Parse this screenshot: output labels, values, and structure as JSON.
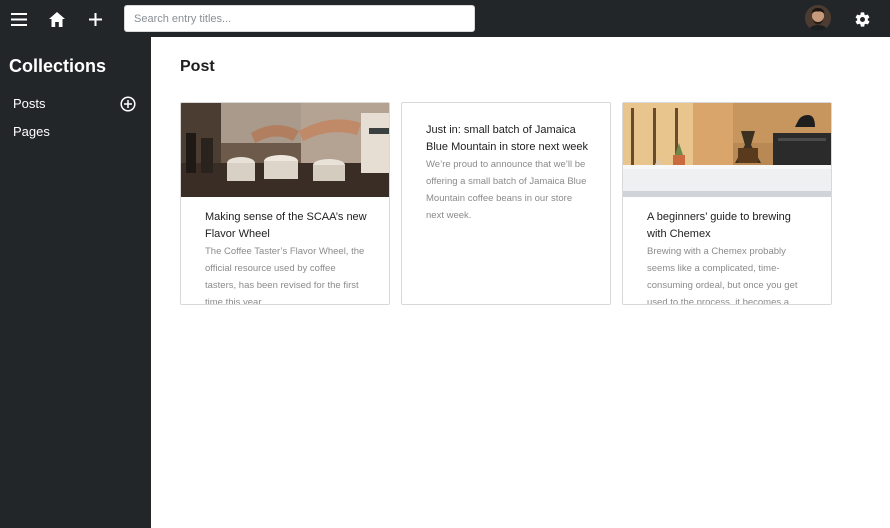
{
  "topbar": {
    "menu_icon": "hamburger-menu-icon",
    "home_icon": "home-icon",
    "add_icon": "plus-icon",
    "search_placeholder": "Search entry titles...",
    "avatar_icon": "user-avatar",
    "settings_icon": "gear-icon"
  },
  "sidebar": {
    "title": "Collections",
    "items": [
      {
        "label": "Posts",
        "action_icon": "add-circle-icon"
      },
      {
        "label": "Pages"
      }
    ]
  },
  "main": {
    "title": "Post",
    "cards": [
      {
        "title": "Making sense of the SCAA’s new Flavor Wheel",
        "description": "The Coffee Taster’s Flavor Wheel, the official resource used by coffee tasters, has been revised for the first time this year.",
        "has_image": true
      },
      {
        "title": "Just in: small batch of Jamaica Blue Mountain in store next week",
        "description": "We’re proud to announce that we’ll be offering a small batch of Jamaica Blue Mountain coffee beans in our store next week.",
        "has_image": false
      },
      {
        "title": "A beginners’ guide to brewing with Chemex",
        "description": "Brewing with a Chemex probably seems like a complicated, time-consuming ordeal, but once you get used to the process, it becomes a soothing ritual.",
        "has_image": true
      }
    ]
  },
  "colors": {
    "chrome": "#232629",
    "background": "#ffffff",
    "card_border": "#d8d8d8",
    "muted_text": "#8b8b8b"
  }
}
